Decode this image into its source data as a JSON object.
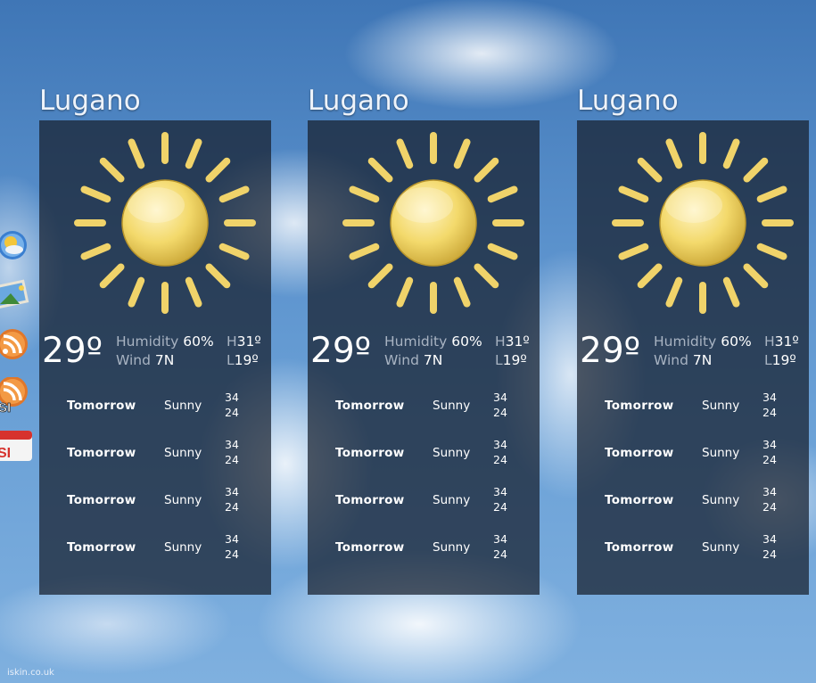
{
  "widgets": [
    {
      "city": "Lugano",
      "weather_icon": "sun-icon",
      "temperature": "29º",
      "humidity_label": "Humidity",
      "humidity_value": "60%",
      "wind_label": "Wind",
      "wind_value": "7N",
      "high_prefix": "H",
      "high_value": "31º",
      "low_prefix": "L",
      "low_value": "19º",
      "forecast": [
        {
          "day": "Tomorrow",
          "condition": "Sunny",
          "high": "34",
          "low": "24"
        },
        {
          "day": "Tomorrow",
          "condition": "Sunny",
          "high": "34",
          "low": "24"
        },
        {
          "day": "Tomorrow",
          "condition": "Sunny",
          "high": "34",
          "low": "24"
        },
        {
          "day": "Tomorrow",
          "condition": "Sunny",
          "high": "34",
          "low": "24"
        }
      ]
    },
    {
      "city": "Lugano",
      "weather_icon": "sun-icon",
      "temperature": "29º",
      "humidity_label": "Humidity",
      "humidity_value": "60%",
      "wind_label": "Wind",
      "wind_value": "7N",
      "high_prefix": "H",
      "high_value": "31º",
      "low_prefix": "L",
      "low_value": "19º",
      "forecast": [
        {
          "day": "Tomorrow",
          "condition": "Sunny",
          "high": "34",
          "low": "24"
        },
        {
          "day": "Tomorrow",
          "condition": "Sunny",
          "high": "34",
          "low": "24"
        },
        {
          "day": "Tomorrow",
          "condition": "Sunny",
          "high": "34",
          "low": "24"
        },
        {
          "day": "Tomorrow",
          "condition": "Sunny",
          "high": "34",
          "low": "24"
        }
      ]
    },
    {
      "city": "Lugano",
      "weather_icon": "sun-icon",
      "temperature": "29º",
      "humidity_label": "Humidity",
      "humidity_value": "60%",
      "wind_label": "Wind",
      "wind_value": "7N",
      "high_prefix": "H",
      "high_value": "31º",
      "low_prefix": "L",
      "low_value": "19º",
      "forecast": [
        {
          "day": "Tomorrow",
          "condition": "Sunny",
          "high": "34",
          "low": "24"
        },
        {
          "day": "Tomorrow",
          "condition": "Sunny",
          "high": "34",
          "low": "24"
        },
        {
          "day": "Tomorrow",
          "condition": "Sunny",
          "high": "34",
          "low": "24"
        },
        {
          "day": "Tomorrow",
          "condition": "Sunny",
          "high": "34",
          "low": "24"
        }
      ]
    }
  ],
  "dock": {
    "icons": [
      "weather-app-icon",
      "photos-app-icon",
      "rss-feed-icon",
      "rss-si-feed-icon",
      "si-calendar-icon"
    ],
    "labels": {
      "rss_si": "SI",
      "calendar_si": "SI"
    }
  },
  "credit": "iskin.co.uk",
  "colors": {
    "panel": "#161e2c",
    "accent_sun": "#f3d96b",
    "sky": "#5a91cc"
  }
}
